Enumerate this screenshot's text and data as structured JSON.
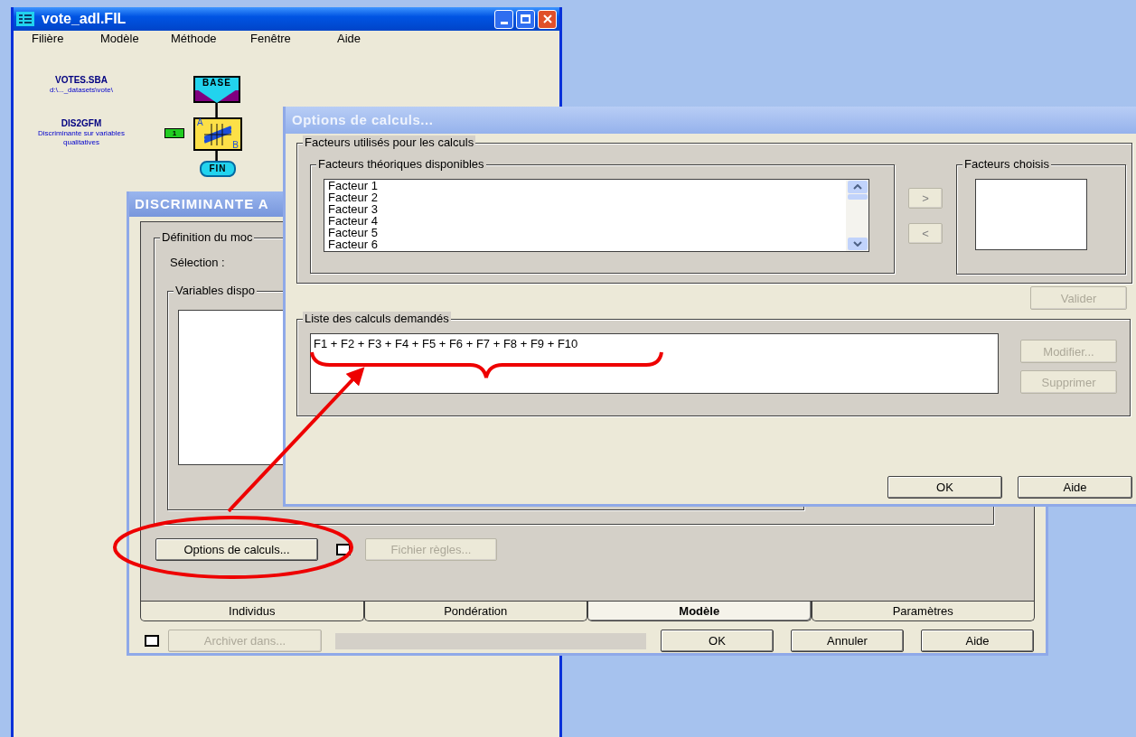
{
  "main_window": {
    "title": "vote_adl.FIL",
    "menu": [
      {
        "label": "Filière"
      },
      {
        "label": "Modèle"
      },
      {
        "label": "Méthode"
      },
      {
        "label": "Fenêtre"
      },
      {
        "label": "Aide"
      }
    ]
  },
  "diagram": {
    "dataset": {
      "name": "VOTES.SBA",
      "path": "d:\\..._datasets\\vote\\"
    },
    "source_node": {
      "label": "BASE"
    },
    "method": {
      "name": "DIS2GFM",
      "description": "Discriminante sur variables qualitatives",
      "badge": "1",
      "corner_labels": [
        "A",
        "B"
      ]
    },
    "end_node": {
      "label": "FIN"
    }
  },
  "discriminant_dialog": {
    "title": "DISCRIMINANTE A",
    "group_title": "Définition du moc",
    "selection_label": "Sélection :",
    "variables_group_title": "Variables dispo",
    "options_button": {
      "label": "Options de calculs...",
      "disabled": false
    },
    "rules_checkbox": {
      "checked": false
    },
    "rules_button": {
      "label": "Fichier règles...",
      "disabled": true
    },
    "tabs": [
      {
        "label": "Individus",
        "selected": false
      },
      {
        "label": "Pondération",
        "selected": false
      },
      {
        "label": "Modèle",
        "selected": true
      },
      {
        "label": "Paramètres",
        "selected": false
      }
    ],
    "archive_checkbox": {
      "checked": false
    },
    "archive_button": {
      "label": "Archiver dans...",
      "disabled": true
    },
    "buttons": [
      {
        "label": "OK",
        "disabled": false
      },
      {
        "label": "Annuler",
        "disabled": false
      },
      {
        "label": "Aide",
        "disabled": false
      }
    ]
  },
  "options_dialog": {
    "title": "Options de calculs...",
    "factors_group_title": "Facteurs utilisés pour les calculs",
    "available_title": "Facteurs théoriques disponibles",
    "available": [
      "Facteur 1",
      "Facteur 2",
      "Facteur 3",
      "Facteur 4",
      "Facteur 5",
      "Facteur 6"
    ],
    "add_button": {
      "label": ">",
      "disabled": true
    },
    "remove_button": {
      "label": "<",
      "disabled": true
    },
    "chosen_title": "Facteurs choisis",
    "validate_button": {
      "label": "Valider",
      "disabled": true
    },
    "calc_list_title": "Liste des calculs demandés",
    "calculations": [
      "F1 + F2 + F3 + F4 + F5 + F6 + F7 + F8 + F9 + F10"
    ],
    "modify_button": {
      "label": "Modifier...",
      "disabled": true
    },
    "delete_button": {
      "label": "Supprimer",
      "disabled": true
    },
    "buttons": [
      {
        "label": "OK",
        "disabled": false
      },
      {
        "label": "Aide",
        "disabled": false
      }
    ]
  }
}
